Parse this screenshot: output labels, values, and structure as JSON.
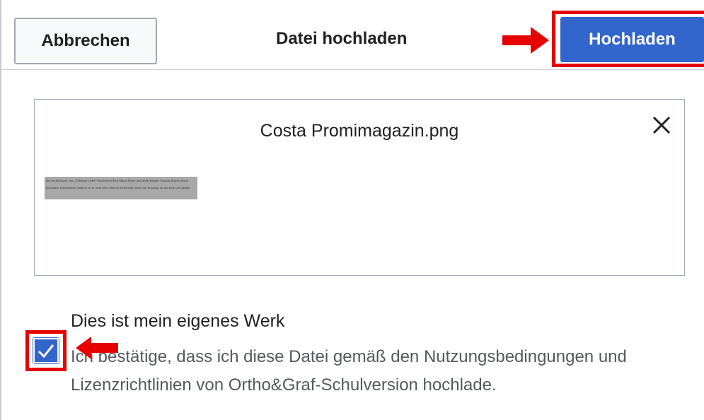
{
  "header": {
    "cancel_label": "Abbrechen",
    "title": "Datei hochladen",
    "upload_label": "Hochladen"
  },
  "preview": {
    "file_name": "Costa Promimagazin.png",
    "thumbnail_text": "Bei der Hochzeit von „Geheime Liebe“-Darstellerin Eva-Maria Biefer und deren Partner Thomas Mayer, einem bekannten Unternehmer kann es zu ei- nem älter: Mayers Exfreundin störte die Trauung, als das Paar sich gerade"
  },
  "own_work": {
    "label": "Dies ist mein eigenes Werk",
    "checked": true,
    "confirmation": "Ich bestätige, dass ich diese Datei gemäß den Nutzungsbedingungen und Lizenzrichtlinien von Ortho&Graf-Schulversion hochlade."
  },
  "colors": {
    "accent": "#3366cc",
    "highlight": "#e60000",
    "border": "#a2a9b1"
  },
  "icons": {
    "close": "close-icon",
    "check": "check-icon",
    "annotation_arrow": "arrow-icon"
  }
}
